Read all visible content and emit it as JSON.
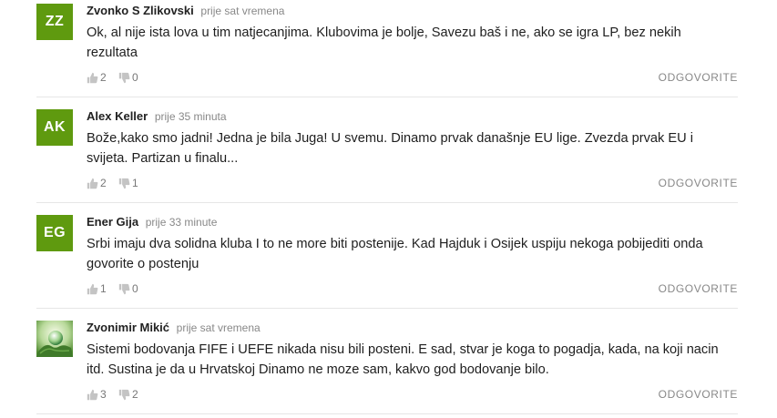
{
  "comments": [
    {
      "initials": "ZZ",
      "avatar_color": "#5f9a0f",
      "author": "Zvonko S Zlikovski",
      "time": "prije sat vremena",
      "text": "Ok, al nije ista lova u tim natjecanjima. Klubovima je bolje, Savezu baš i ne, ako se igra LP, bez nekih rezultata",
      "likes": "2",
      "dislikes": "0",
      "reply": "ODGOVORITE"
    },
    {
      "initials": "AK",
      "avatar_color": "#5f9a0f",
      "author": "Alex Keller",
      "time": "prije 35 minuta",
      "text": "Bože,kako smo jadni! Jedna je bila Juga! U svemu. Dinamo prvak današnje EU lige. Zvezda prvak EU i svijeta. Partizan u finalu...",
      "likes": "2",
      "dislikes": "1",
      "reply": "ODGOVORITE"
    },
    {
      "initials": "EG",
      "avatar_color": "#5f9a0f",
      "author": "Ener Gija",
      "time": "prije 33 minute",
      "text": "Srbi imaju dva solidna kluba I to ne more biti postenije. Kad Hajduk i Osijek uspiju nekoga pobijediti onda govorite o postenju",
      "likes": "1",
      "dislikes": "0",
      "reply": "ODGOVORITE"
    },
    {
      "avatar_icon": "globe-in-hands-photo",
      "author": "Zvonimir Mikić",
      "time": "prije sat vremena",
      "text": "Sistemi bodovanja FIFE i UEFE nikada nisu bili posteni. E sad, stvar je koga to pogadja, kada, na koji nacin itd. Sustina je da u Hrvatskoj Dinamo ne moze sam, kakvo god bodovanje bilo.",
      "likes": "3",
      "dislikes": "2",
      "reply": "ODGOVORITE"
    }
  ]
}
